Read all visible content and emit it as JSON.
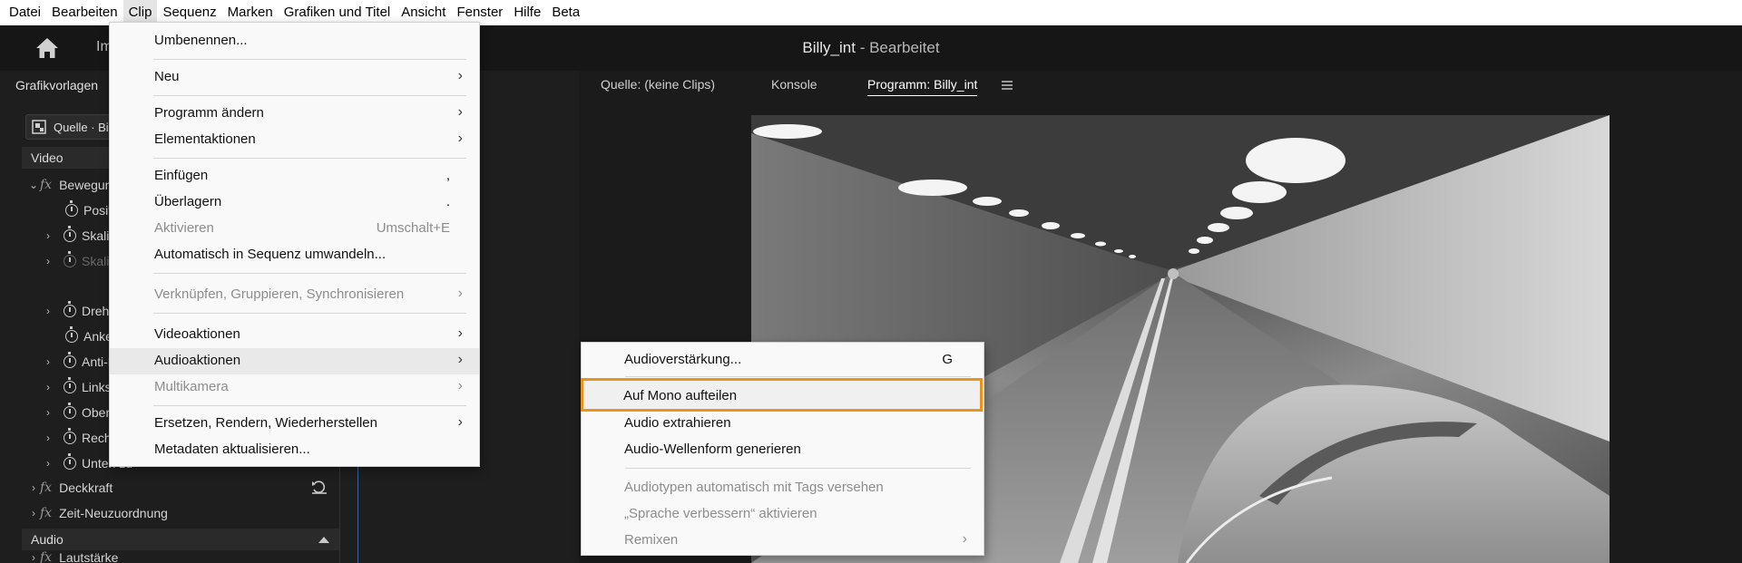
{
  "menubar": {
    "items": [
      {
        "label": "Datei"
      },
      {
        "label": "Bearbeiten"
      },
      {
        "label": "Clip",
        "active": true
      },
      {
        "label": "Sequenz"
      },
      {
        "label": "Marken"
      },
      {
        "label": "Grafiken und Titel"
      },
      {
        "label": "Ansicht"
      },
      {
        "label": "Fenster"
      },
      {
        "label": "Hilfe"
      },
      {
        "label": "Beta"
      }
    ]
  },
  "header": {
    "import_tab": "Impo",
    "project_name": "Billy_int",
    "project_status": " - Bearbeitet"
  },
  "left_panel": {
    "title": "Grafikvorlagen",
    "source_selector": "Quelle · BillL",
    "video_section": "Video",
    "effects": [
      {
        "label": "Bewegung",
        "fx": true
      },
      {
        "label": "Position"
      },
      {
        "label": "Skaliere"
      },
      {
        "label": "Skalieru",
        "disabled": true
      },
      {
        "label": "Drehung"
      },
      {
        "label": "Ankerpu"
      },
      {
        "label": "Anti-Flir"
      },
      {
        "label": "Links zu"
      },
      {
        "label": "Oben zu"
      },
      {
        "label": "Rechts z"
      },
      {
        "label": "Unten zu"
      },
      {
        "label": "Deckkraft",
        "fx": true
      },
      {
        "label": "Zeit-Neuzuordnung",
        "fx": true
      }
    ],
    "audio_section": "Audio",
    "audio_partial": "Lautstärke"
  },
  "program_panel": {
    "tabs": [
      "Quelle: (keine Clips)",
      "Konsole",
      "Programm: Billy_int"
    ]
  },
  "clip_menu": {
    "items": [
      {
        "label": "Umbenennen..."
      },
      {
        "label": "Neu",
        "submenu": true
      },
      {
        "label": "Programm ändern",
        "submenu": true
      },
      {
        "label": "Elementaktionen",
        "submenu": true
      },
      {
        "label": "Einfügen",
        "shortcut": ","
      },
      {
        "label": "Überlagern",
        "shortcut": "."
      },
      {
        "label": "Aktivieren",
        "shortcut": "Umschalt+E",
        "disabled": true
      },
      {
        "label": "Automatisch in Sequenz umwandeln..."
      },
      {
        "label": "Verknüpfen, Gruppieren, Synchronisieren",
        "submenu": true,
        "disabled": true
      },
      {
        "label": "Videoaktionen",
        "submenu": true
      },
      {
        "label": "Audioaktionen",
        "submenu": true,
        "hover": true
      },
      {
        "label": "Multikamera",
        "submenu": true,
        "disabled": true
      },
      {
        "label": "Ersetzen, Rendern, Wiederherstellen",
        "submenu": true
      },
      {
        "label": "Metadaten aktualisieren..."
      }
    ]
  },
  "audio_submenu": {
    "items": [
      {
        "label": "Audioverstärkung...",
        "shortcut": "G"
      },
      {
        "label": "Auf Mono aufteilen",
        "highlighted": true
      },
      {
        "label": "Audio extrahieren"
      },
      {
        "label": "Audio-Wellenform generieren"
      },
      {
        "label": "Audiotypen automatisch mit Tags versehen",
        "disabled": true
      },
      {
        "label": "„Sprache verbessern“ aktivieren",
        "disabled": true
      },
      {
        "label": "Remixen",
        "submenu": true,
        "disabled": true
      }
    ]
  },
  "colors": {
    "highlight_border": "#e8941e",
    "timeline_indicator": "#3a63a8"
  }
}
